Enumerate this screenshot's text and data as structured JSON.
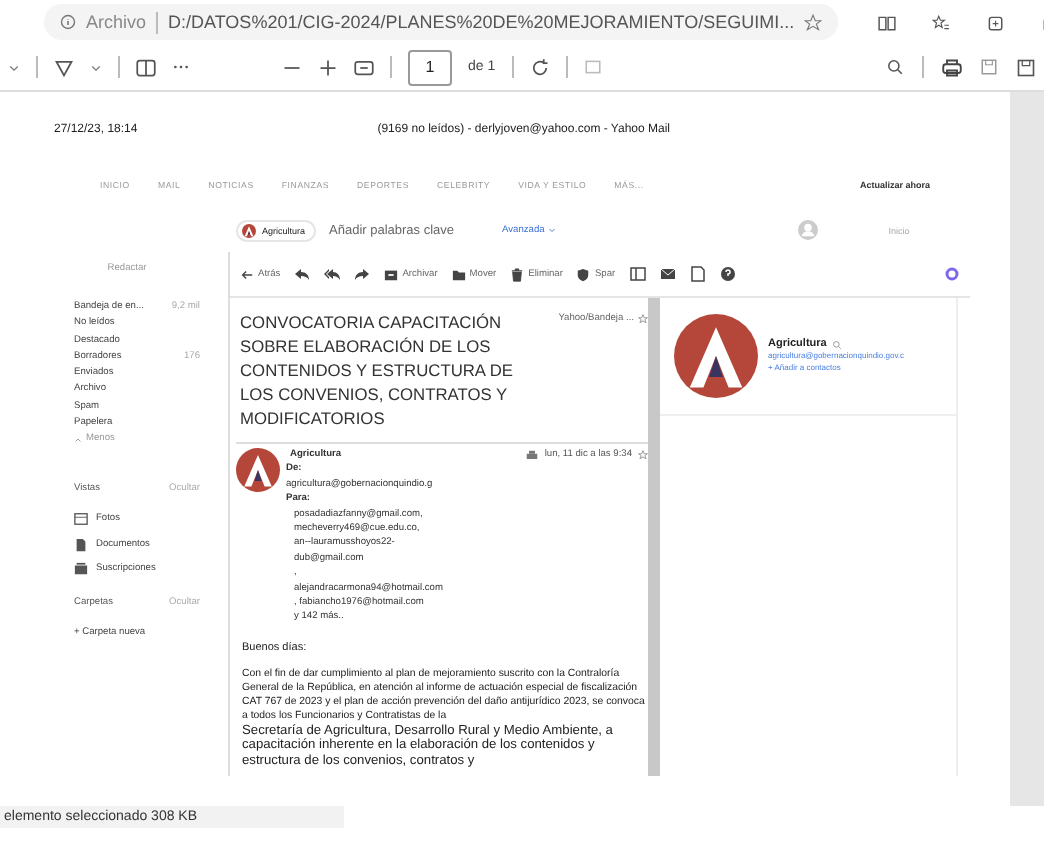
{
  "address_bar": {
    "label": "Archivo",
    "url": "D:/DATOS%201/CIG-2024/PLANES%20DE%20MEJORAMIENTO/SEGUIMI..."
  },
  "pdf_toolbar": {
    "page": "1",
    "page_count": "de 1"
  },
  "page": {
    "timestamp": "27/12/23, 18:14",
    "title": "(9169 no leídos) - derlyjoven@yahoo.com - Yahoo Mail",
    "nav": [
      {
        "label": "INICIO"
      },
      {
        "label": "MAIL"
      },
      {
        "label": "NOTICIAS"
      },
      {
        "label": "FINANZAS"
      },
      {
        "label": "DEPORTES"
      },
      {
        "label": "CELEBRITY"
      },
      {
        "label": "VIDA Y ESTILO"
      },
      {
        "label": "MÁS..."
      }
    ],
    "update_button": "Actualizar ahora",
    "search": {
      "chip": "Agricultura",
      "placeholder": "Añadir palabras clave",
      "advanced": "Avanzada",
      "home": "Inicio"
    },
    "sidebar": {
      "compose": "Redactar",
      "folders": [
        {
          "label": "Bandeja de en...",
          "count": "9,2 mil"
        },
        {
          "label": "No leídos"
        },
        {
          "label": "Destacado"
        },
        {
          "label": "Borradores",
          "count": "176"
        },
        {
          "label": "Enviados"
        },
        {
          "label": "Archivo"
        },
        {
          "label": "Spam"
        },
        {
          "label": "Papelera"
        }
      ],
      "less": "Menos",
      "sections": [
        {
          "title": "Vistas",
          "toggle": "Ocultar",
          "items": [
            {
              "label": "Fotos",
              "kind": "photos"
            },
            {
              "label": "Documentos",
              "kind": "documents"
            },
            {
              "label": "Suscripciones",
              "kind": "subscriptions"
            }
          ]
        },
        {
          "title": "Carpetas",
          "toggle": "Ocultar",
          "items": [
            {
              "label": "+ Carpeta nueva",
              "kind": "new"
            }
          ]
        }
      ]
    },
    "toolbar": [
      {
        "kind": "back",
        "label": "Atrás"
      },
      {
        "kind": "reply"
      },
      {
        "kind": "reply-all"
      },
      {
        "kind": "forward"
      },
      {
        "kind": "archive",
        "label": "Archivar"
      },
      {
        "kind": "move",
        "label": "Mover"
      },
      {
        "kind": "delete",
        "label": "Eliminar"
      },
      {
        "kind": "spam",
        "label": "Spar"
      },
      {
        "kind": "view"
      },
      {
        "kind": "mail"
      },
      {
        "kind": "note"
      },
      {
        "kind": "help"
      }
    ],
    "message": {
      "subject": "CONVOCATORIA CAPACITACIÓN SOBRE ELABORACIÓN DE LOS CONTENIDOS Y ESTRUCTURA DE LOS CONVENIOS, CONTRATOS Y MODIFICATORIOS",
      "folder": "Yahoo/Bandeja ...",
      "sender": "Agricultura",
      "from_label": "De:",
      "from": "agricultura@gobernacionquindio.g",
      "to_label": "Para:",
      "recipients": [
        "posadadiazfanny@gmail.com,",
        "mecheverry469@cue.edu.co,",
        "an--lauramusshoyos22-",
        "dub@gmail.com",
        ",",
        "alejandracarmona94@hotmail.com",
        ", fabiancho1976@hotmail.com",
        "y 142 más.."
      ],
      "date": "lun, 11 dic a las 9:34",
      "greeting": "Buenos días:",
      "body": [
        "Con el fin de dar cumplimiento al plan de mejoramiento suscrito con la Contraloría General de la República, en atención al informe de actuación especial de fiscalización CAT 767 de 2023 y el plan de acción prevención del daño antijurídico 2023, se convoca a todos los Funcionarios y Contratistas de la",
        "Secretaría de Agricultura, Desarrollo Rural y Medio Ambiente, a capacitación inherente en la elaboración de los contenidos y estructura de los convenios, contratos y"
      ]
    },
    "contact": {
      "name": "Agricultura",
      "email": "agricultura@gobernacionquindio.gov.c",
      "add": "+ Añadir a contactos"
    }
  },
  "status_bar": "elemento seleccionado 308 KB"
}
